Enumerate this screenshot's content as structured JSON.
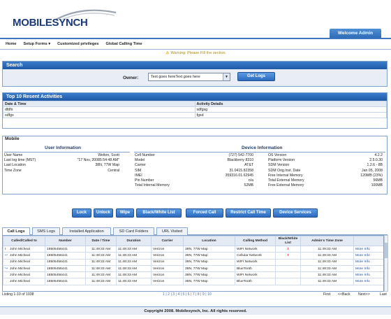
{
  "brand": {
    "name": "MOBILESYNCH"
  },
  "header": {
    "welcome": "Welcome Admin"
  },
  "menu": [
    "Home",
    "Setup Forms",
    "Customized privileges",
    "Global Calling Time"
  ],
  "warning": "Warning: Please Fill the section",
  "search": {
    "title": "Search",
    "owner_label": "Owner:",
    "owner_value": "Text goes hereText goes here",
    "button": "Get Logs"
  },
  "top10": {
    "title": "Top 10 Resent Activities",
    "columns": [
      "Date & Time",
      "Activity Details"
    ],
    "rows": [
      [
        "dfdfs",
        "sdfgsg"
      ],
      [
        "sdfgs",
        "fgsd"
      ]
    ]
  },
  "mobile": {
    "title": "Mobile",
    "user_info_title": "User Information",
    "device_info_title": "Device Information",
    "user_info": [
      {
        "k": "User Name",
        "v": "Welton, Scott"
      },
      {
        "k": "Last log time (MST)",
        "v": "\"17 Nov, 20085:54:48 AM\""
      },
      {
        "k": "Last Location",
        "v": "38N, 77W Map"
      },
      {
        "k": "Time Zone",
        "v": "Central"
      }
    ],
    "device_col1": [
      {
        "k": "Cell Number",
        "v": "(727) 542-7700"
      },
      {
        "k": "Model",
        "v": "Blackberry 8310"
      },
      {
        "k": "Carrier",
        "v": "AT&T"
      },
      {
        "k": "SIM",
        "v": "31.0415.82358"
      },
      {
        "k": "IMEI",
        "v": "359316.01.62945"
      },
      {
        "k": "Pin Number",
        "v": "n/a"
      },
      {
        "k": "Total Internal Memory",
        "v": "52MB"
      }
    ],
    "device_col2": [
      {
        "k": "OS Version",
        "v": "4.2.2"
      },
      {
        "k": "Platform Version",
        "v": "2.5.0.30"
      },
      {
        "k": "SDM Version",
        "v": "1.2.6 - 8B"
      },
      {
        "k": "SDM Orig.Inst. Date",
        "v": "Jan 05, 2008"
      },
      {
        "k": "Free Internal Memory",
        "v": "120MB (23%)"
      },
      {
        "k": "Total External Memory",
        "v": "56MB"
      },
      {
        "k": "Free External Memory",
        "v": "100MB"
      }
    ]
  },
  "actions": [
    "Lock",
    "Unlock",
    "Wipe",
    "Black/White List",
    "Forced Call",
    "Restrict Call Time",
    "Device Services"
  ],
  "tabs": [
    "Call Logs",
    "SMS Logs",
    "Installed Application",
    "SD Card Folders",
    "URL Visited"
  ],
  "logs": {
    "columns": [
      "Called/Called to",
      "Number",
      "Date / Time",
      "Duration",
      "Carrier",
      "Location",
      "Calling Method",
      "Black/White List",
      "Admin's Time Zone",
      ""
    ],
    "rows": [
      {
        "icon": "!",
        "name": "John Micheal",
        "number": "18505456441",
        "date": "11:49:33 AM",
        "duration": "11:49:33 AM",
        "carrier": "Verizon",
        "location": "38N, 77W Map",
        "method": "WIFI Network",
        "bw": "!",
        "tz": "11:49:33 AM",
        "more": "More Info"
      },
      {
        "icon": "↩",
        "name": "John Micheal",
        "number": "18505456441",
        "date": "11:49:33 AM",
        "duration": "11:49:33 AM",
        "carrier": "Verizon",
        "location": "38N, 77W Map",
        "method": "Cellular Network",
        "bw": "!",
        "tz": "11:49:33 AM",
        "more": "More Info"
      },
      {
        "icon": "",
        "name": "John Micheal",
        "number": "18505456441",
        "date": "11:49:33 AM",
        "duration": "11:49:33 AM",
        "carrier": "Verizon",
        "location": "38N, 77W Map",
        "method": "WIFI Network",
        "bw": "",
        "tz": "11:49:33 AM",
        "more": "More Info"
      },
      {
        "icon": "↪",
        "name": "John Micheal",
        "number": "18505456441",
        "date": "11:49:33 AM",
        "duration": "11:49:33 AM",
        "carrier": "Verizon",
        "location": "38N, 77W Map",
        "method": "BlueTooth",
        "bw": "",
        "tz": "11:49:33 AM",
        "more": "More Info"
      },
      {
        "icon": "",
        "name": "John Micheal",
        "number": "18505456441",
        "date": "11:49:33 AM",
        "duration": "11:49:33 AM",
        "carrier": "Verizon",
        "location": "38N, 77W Map",
        "method": "WIFI Network",
        "bw": "",
        "tz": "11:49:33 AM",
        "more": "More Info"
      },
      {
        "icon": "",
        "name": "John Micheal",
        "number": "18505456441",
        "date": "11:49:33 AM",
        "duration": "11:49:33 AM",
        "carrier": "Verizon",
        "location": "38N, 77W Map",
        "method": "BlueTooth",
        "bw": "",
        "tz": "11:49:33 AM",
        "more": "More Info"
      }
    ]
  },
  "pager": {
    "listing": "Listing 1-10 of 1038",
    "pages": "1 | 2 | 3 | 4 | 5 | 6 | 7 | 8 | 9 | 10",
    "first": "First",
    "back": "<<Back",
    "next": "Next>>",
    "last": "Last"
  },
  "footer": "Copyright 2008. Mobilesynch, Inc. All rights reserved.",
  "colors": {
    "accent": "#2f6cb8",
    "header_bar": "#1f59a6"
  }
}
